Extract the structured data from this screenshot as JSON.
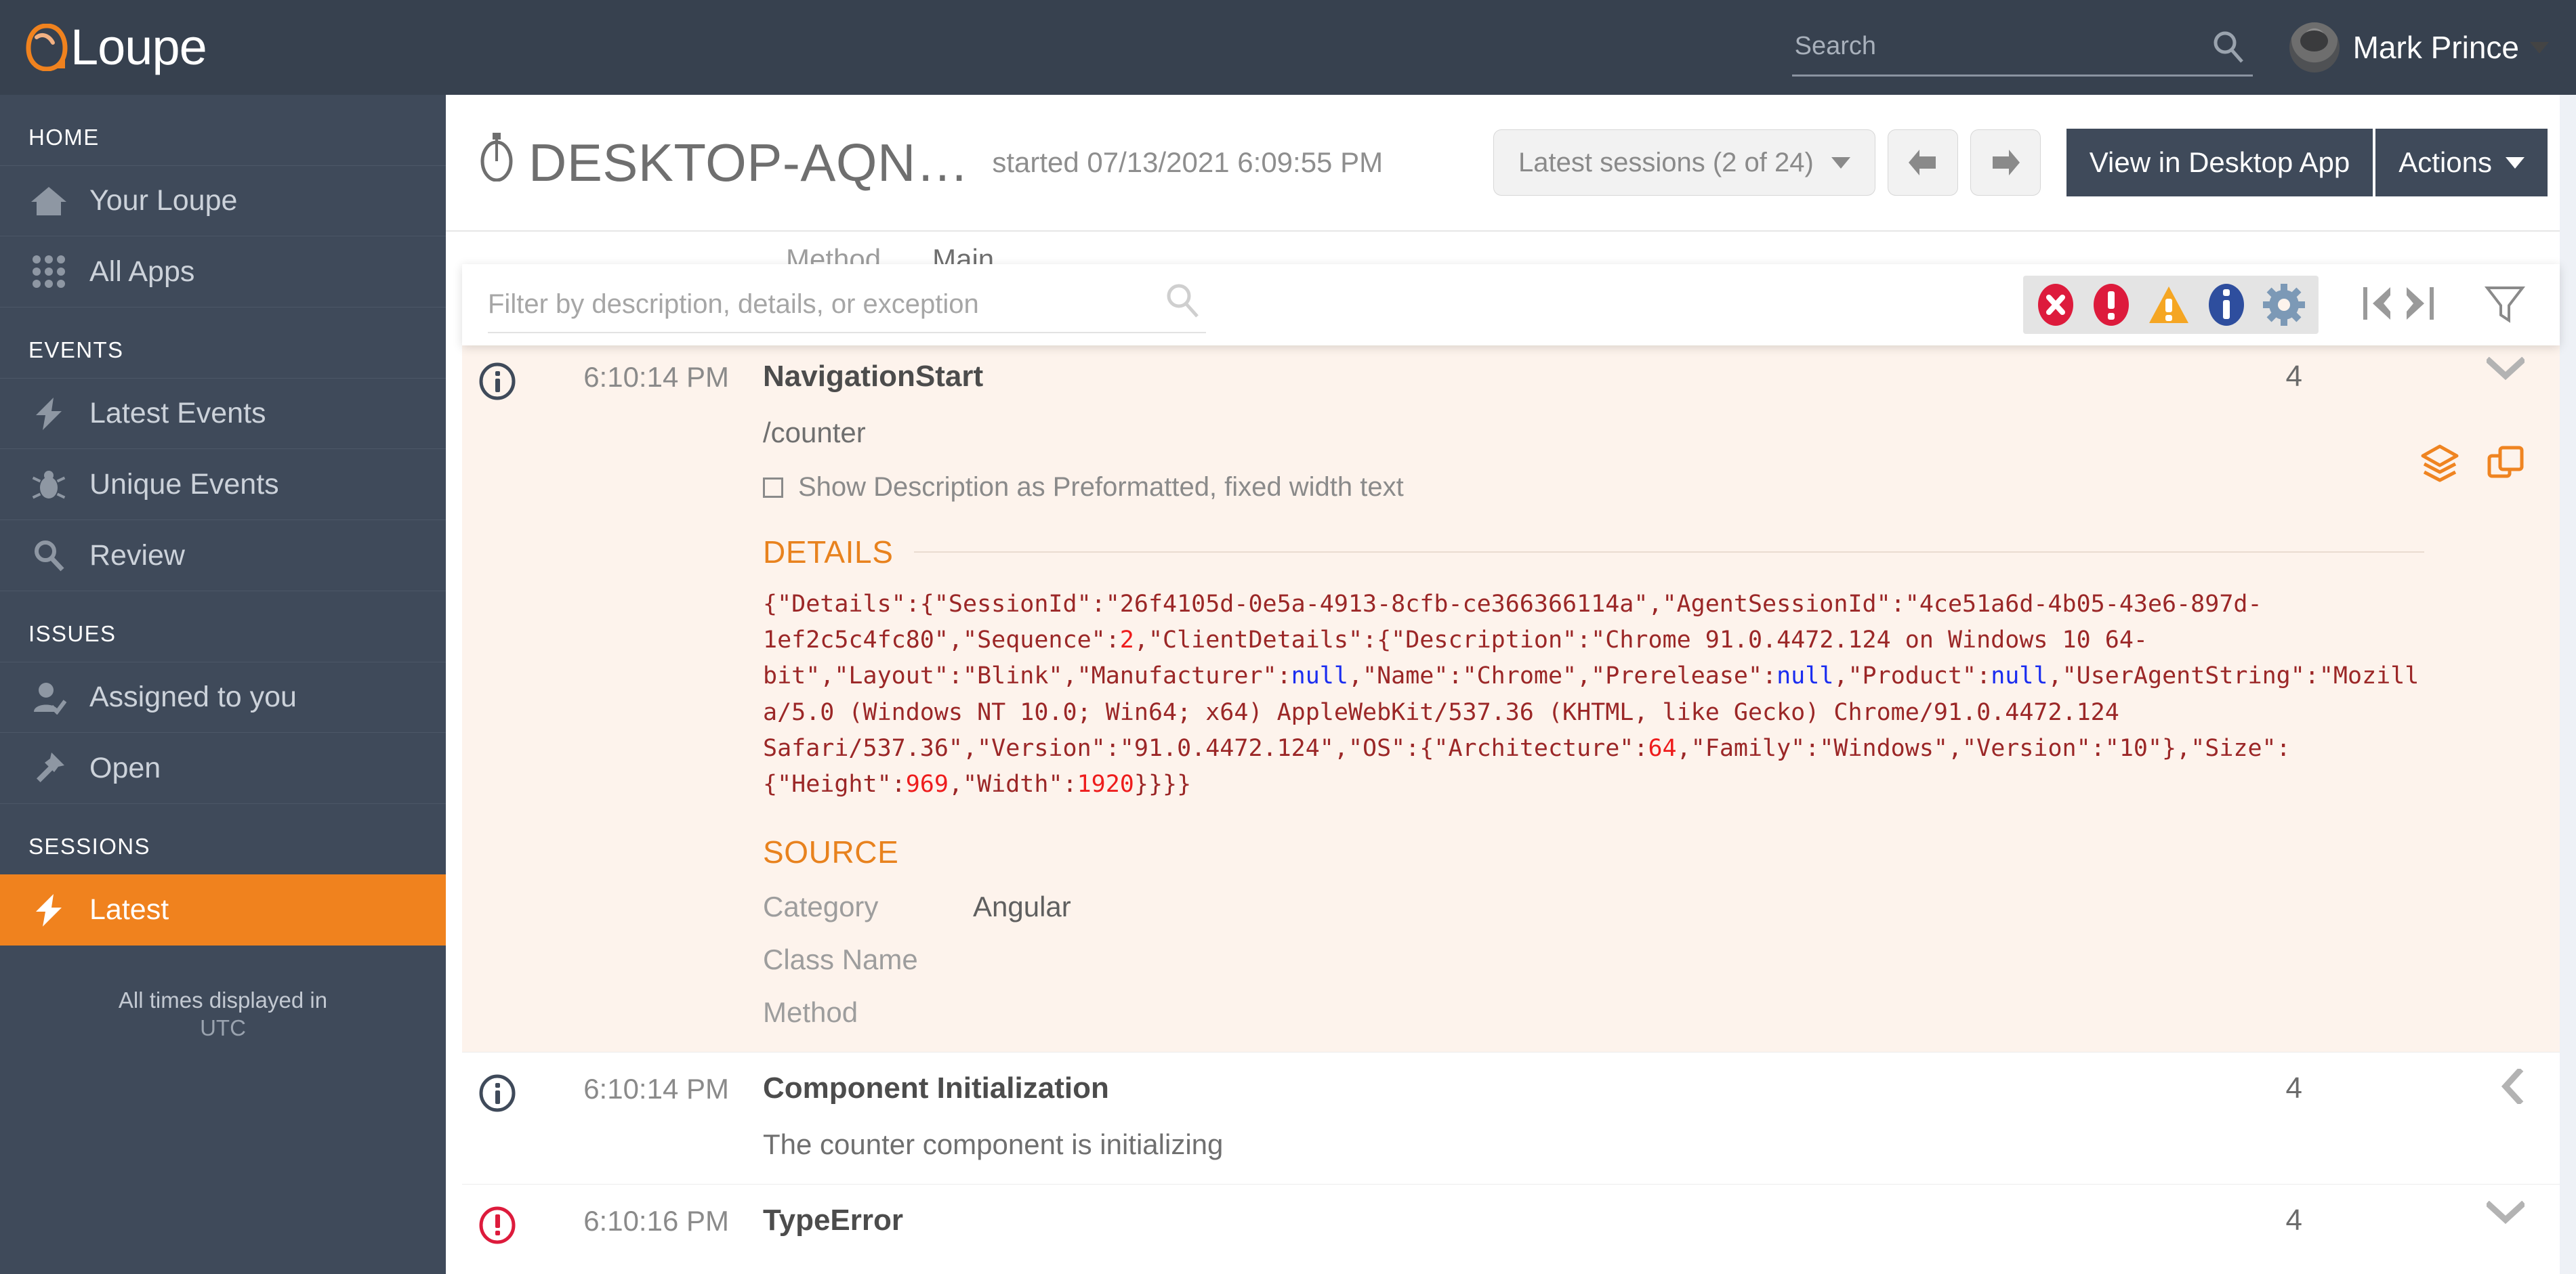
{
  "brand": {
    "name": "Loupe"
  },
  "topbar": {
    "search_placeholder": "Search",
    "search_value": "",
    "user_name": "Mark Prince"
  },
  "sidebar": {
    "groups": [
      {
        "label": "HOME",
        "items": [
          {
            "label": "Your Loupe",
            "icon": "home-icon",
            "active": false
          },
          {
            "label": "All Apps",
            "icon": "grid-icon",
            "active": false
          }
        ]
      },
      {
        "label": "EVENTS",
        "items": [
          {
            "label": "Latest Events",
            "icon": "bolt-icon",
            "active": false
          },
          {
            "label": "Unique Events",
            "icon": "bug-icon",
            "active": false
          },
          {
            "label": "Review",
            "icon": "search-icon",
            "active": false
          }
        ]
      },
      {
        "label": "ISSUES",
        "items": [
          {
            "label": "Assigned to you",
            "icon": "user-check-icon",
            "active": false
          },
          {
            "label": "Open",
            "icon": "pin-icon",
            "active": false
          }
        ]
      },
      {
        "label": "SESSIONS",
        "items": [
          {
            "label": "Latest",
            "icon": "bolt-icon",
            "active": true
          }
        ]
      }
    ],
    "footer_line1": "All times displayed in",
    "footer_line2": "UTC"
  },
  "page": {
    "title": "DESKTOP-AQN…",
    "subtitle": "started 07/13/2021 6:09:55 PM",
    "sessions_select": "Latest sessions (2 of 24)",
    "prev_label": "",
    "next_label": "",
    "view_desktop_label": "View in Desktop App",
    "actions_label": "Actions"
  },
  "cut_row": {
    "label": "Method",
    "value": "Main"
  },
  "filterbar": {
    "placeholder": "Filter by description, details, or exception",
    "value": "",
    "severities": [
      {
        "name": "critical",
        "color": "#dd1b3c"
      },
      {
        "name": "error",
        "color": "#dd1b3c"
      },
      {
        "name": "warning",
        "color": "#f5a623"
      },
      {
        "name": "information",
        "color": "#2e4e9e"
      },
      {
        "name": "verbose",
        "color": "#7c99b6"
      }
    ]
  },
  "events": [
    {
      "severity": "information",
      "time": "6:10:14 PM",
      "caption": "NavigationStart",
      "count": "4",
      "expanded": true,
      "description": "/counter",
      "preformatted_label": "Show Description as Preformatted, fixed width text",
      "details_heading": "DETAILS",
      "details_json": "{\"Details\":{\"SessionId\":\"26f4105d-0e5a-4913-8cfb-ce366366114a\",\"AgentSessionId\":\"4ce51a6d-4b05-43e6-897d-1ef2c5c4fc80\",\"Sequence\":2,\"ClientDetails\":{\"Description\":\"Chrome 91.0.4472.124 on Windows 10 64-bit\",\"Layout\":\"Blink\",\"Manufacturer\":null,\"Name\":\"Chrome\",\"Prerelease\":null,\"Product\":null,\"UserAgentString\":\"Mozilla/5.0 (Windows NT 10.0; Win64; x64) AppleWebKit/537.36 (KHTML, like Gecko) Chrome/91.0.4472.124 Safari/537.36\",\"Version\":\"91.0.4472.124\",\"OS\":{\"Architecture\":64,\"Family\":\"Windows\",\"Version\":\"10\"},\"Size\":{\"Height\":969,\"Width\":1920}}}}",
      "source_heading": "SOURCE",
      "source": [
        {
          "key": "Category",
          "value": "Angular"
        },
        {
          "key": "Class Name",
          "value": ""
        },
        {
          "key": "Method",
          "value": ""
        }
      ]
    },
    {
      "severity": "information",
      "time": "6:10:14 PM",
      "caption": "Component Initialization",
      "count": "4",
      "expanded": false,
      "description": "The counter component is initializing"
    },
    {
      "severity": "error",
      "time": "6:10:16 PM",
      "caption": "TypeError",
      "count": "4",
      "expanded": false,
      "description": ""
    }
  ]
}
